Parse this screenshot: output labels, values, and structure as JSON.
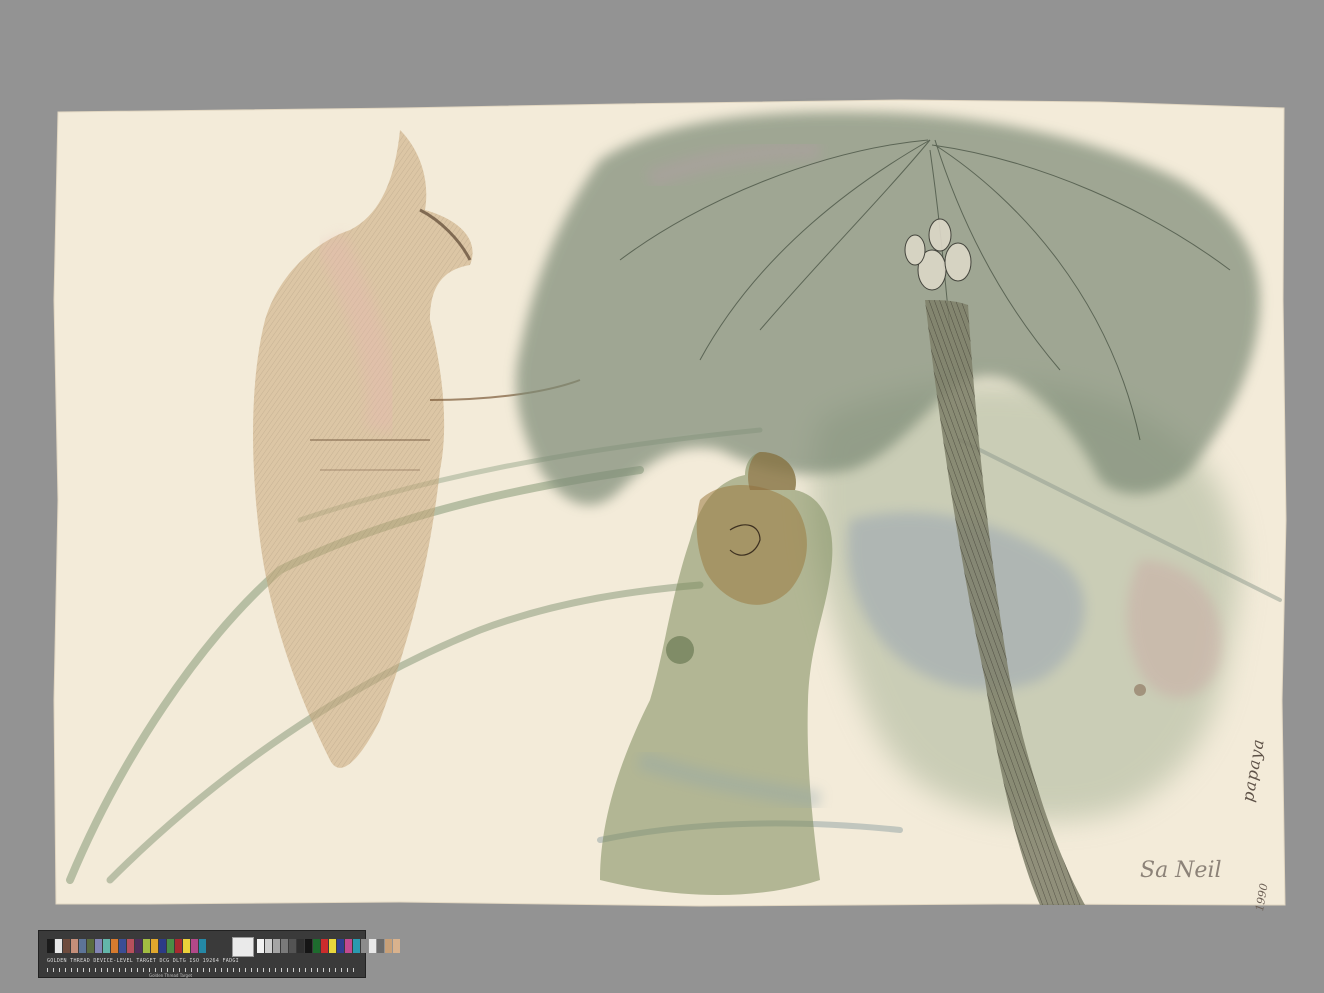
{
  "artwork": {
    "title_inscription": "papaya",
    "year_inscription": "1990",
    "signature": "Sa Neil"
  },
  "color_target": {
    "patches_left": [
      "#1b1b1b",
      "#e6e6e6",
      "#6e4b3d",
      "#c58f7a",
      "#5d7497",
      "#5a6b3f",
      "#8285b5",
      "#63b6aa",
      "#d77b2e",
      "#3b4e95",
      "#b8505c",
      "#4e2f5a",
      "#a3bd42",
      "#e1a82d",
      "#2c3b87",
      "#4b8e45",
      "#a82a30",
      "#ecd13a",
      "#b24889",
      "#2488a6"
    ],
    "patches_right": [
      "#f2f2f2",
      "#cfcfcf",
      "#a5a5a5",
      "#7a7a7a",
      "#545454",
      "#2f2f2f",
      "#151515",
      "#1e6b2e",
      "#cc2c2c",
      "#e7d63c",
      "#2f3e90",
      "#c24a8f",
      "#2a9ab0",
      "#8c8c8c",
      "#e8e8e8",
      "#6b6b6b",
      "#c8a078",
      "#d9b28d"
    ],
    "label": "GOLDEN THREAD  DEVICE-LEVEL TARGET  DCG DLTG  ISO 19264  FADGI",
    "footer": "Golden Thread Target"
  },
  "colors": {
    "background": "#939393",
    "paper": "#f3ebd9",
    "palm": "#6e7e68",
    "figure_left": "#a7834f",
    "figure_right": "#7d6a3c"
  }
}
